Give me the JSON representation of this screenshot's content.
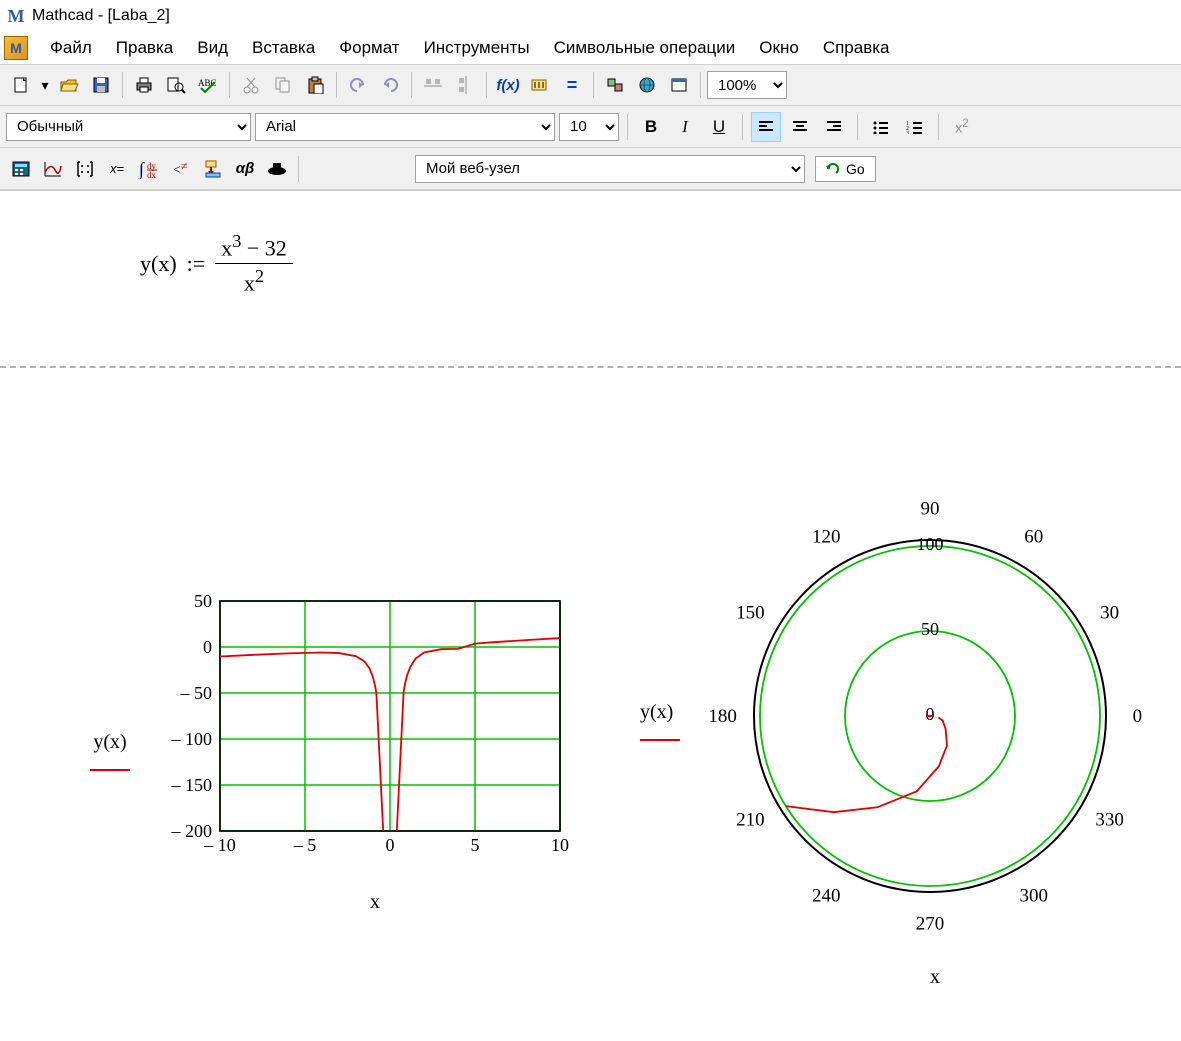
{
  "app": {
    "title": "Mathcad - [Laba_2]"
  },
  "menu": {
    "items": [
      "Файл",
      "Правка",
      "Вид",
      "Вставка",
      "Формат",
      "Инструменты",
      "Символьные операции",
      "Окно",
      "Справка"
    ]
  },
  "toolbar1": {
    "zoom": "100%"
  },
  "format_toolbar": {
    "style": "Обычный",
    "font": "Arial",
    "size": "10"
  },
  "math_toolbar": {
    "web": "Мой веб-узел",
    "go_label": "Go"
  },
  "equation": {
    "lhs": "y(x)",
    "def": ":=",
    "num_base1": "x",
    "num_exp1": "3",
    "num_op": "−",
    "num_const": "32",
    "den_base": "x",
    "den_exp": "2"
  },
  "xy_label_y": "y(x)",
  "xy_label_x": "x",
  "polar_label_y": "y(x)",
  "polar_label_x": "x",
  "chart_data": [
    {
      "type": "line",
      "title": "",
      "xlabel": "x",
      "ylabel": "y(x)",
      "xlim": [
        -10,
        10
      ],
      "ylim": [
        -200,
        50
      ],
      "x_ticks": [
        -10,
        -5,
        0,
        5,
        10
      ],
      "y_ticks": [
        -200,
        -150,
        -100,
        -50,
        0,
        50
      ],
      "series": [
        {
          "name": "y(x)",
          "color": "#e00000",
          "x": [
            -10,
            -8,
            -6,
            -4,
            -3,
            -2,
            -1.5,
            -1.2,
            -1,
            -0.9,
            -0.85,
            -0.8,
            0.8,
            0.85,
            0.9,
            1,
            1.2,
            1.5,
            2,
            3,
            4,
            5,
            6,
            8,
            10
          ],
          "y": [
            -10.32,
            -8.5,
            -6.9,
            -6,
            -6.6,
            -10,
            -15.7,
            -23.4,
            -33,
            -40.4,
            -45.1,
            -50.8,
            -49.2,
            -43.4,
            -38.6,
            -31,
            -21.4,
            -12.7,
            -6,
            -2.4,
            -2.0,
            3.7,
            5.1,
            7.5,
            9.7
          ]
        }
      ]
    },
    {
      "type": "polar",
      "xlabel": "x",
      "ylabel": "y(x)",
      "angle_ticks": [
        0,
        30,
        60,
        90,
        120,
        150,
        180,
        210,
        240,
        270,
        300,
        330
      ],
      "radius_ticks": [
        0,
        50,
        100
      ],
      "r_max": 100,
      "series": [
        {
          "name": "y(x)",
          "color": "#e00000",
          "theta_deg": [
            350,
            340,
            320,
            300,
            280,
            260,
            240,
            225,
            212
          ],
          "r": [
            5,
            8,
            12,
            20,
            30,
            45,
            62,
            80,
            100
          ]
        }
      ]
    }
  ]
}
